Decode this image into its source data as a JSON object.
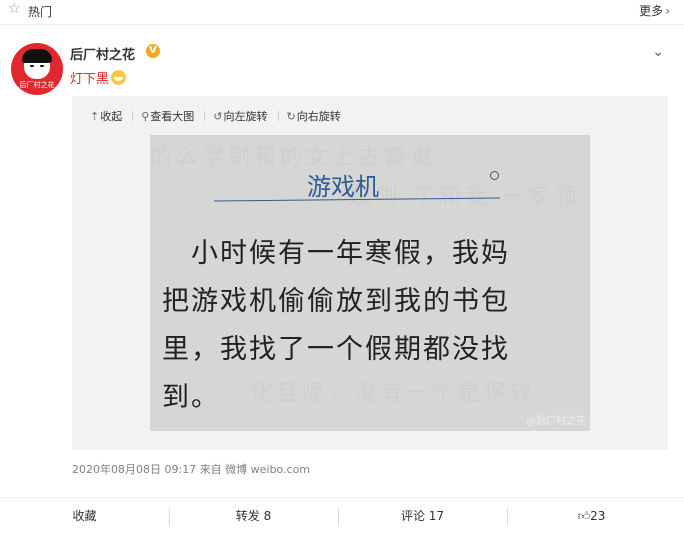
{
  "topbar": {
    "title": "热门",
    "more": "更多"
  },
  "post": {
    "author": "后厂村之花",
    "avatar_caption": "后厂村之花",
    "text": "灯下黑",
    "emoji": "laugh-cry-emoji"
  },
  "media_toolbar": {
    "collapse": "收起",
    "view_large": "查看大图",
    "rotate_left": "向左旋转",
    "rotate_right": "向右旋转"
  },
  "photo": {
    "title": "游戏机",
    "lines": [
      "　小时候有一年寒假，我妈",
      "把游戏机偷偷放到我的书包",
      "里，我找了一个假期都没找",
      "到。"
    ],
    "ghost_top": "的么学制和的女上古雷说",
    "ghost_mid": "起则 了和我 一家领",
    "ghost_bottom": "化且呢，没有一个是保较",
    "watermark": "@后厂村之花"
  },
  "meta": {
    "timestamp": "2020年08月08日 09:17",
    "source": "来自 微博 weibo.com"
  },
  "actions": {
    "favorite": "收藏",
    "repost": "转发 8",
    "comment": "评论 17",
    "like": "23"
  },
  "colors": {
    "accent": "#e1282c",
    "ink_blue": "#2f5c96",
    "badge": "#f5a623"
  }
}
